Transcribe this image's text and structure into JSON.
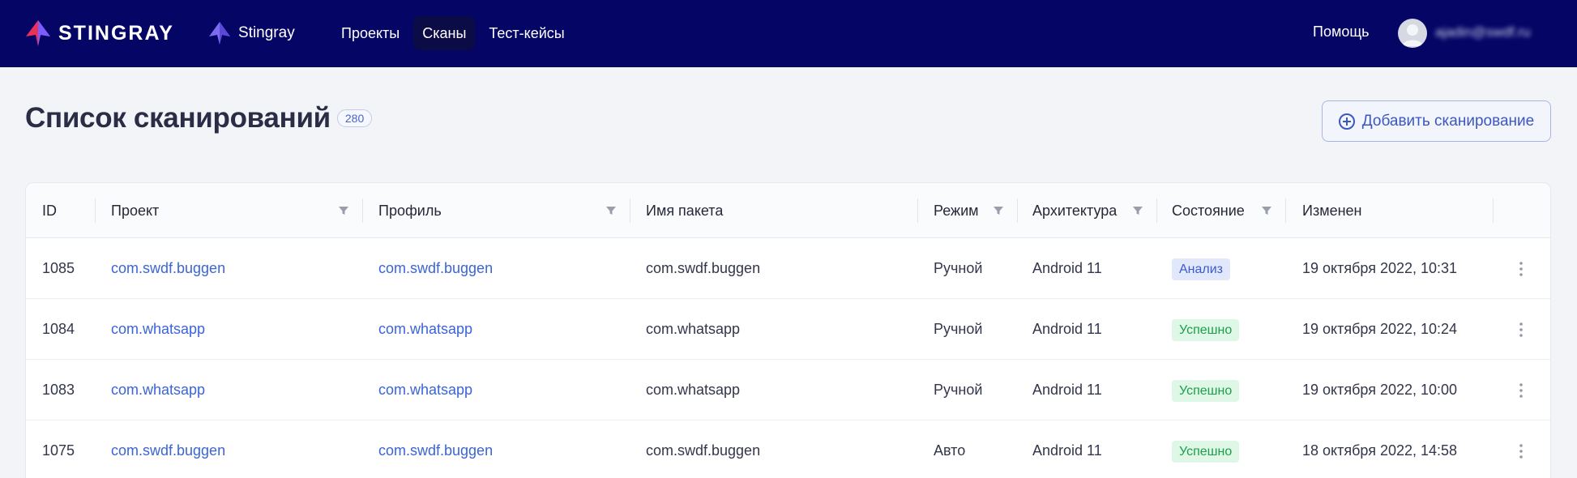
{
  "brand": {
    "name": "STINGRAY"
  },
  "app": {
    "name": "Stingray"
  },
  "nav": [
    "Проекты",
    "Сканы",
    "Тест-кейсы"
  ],
  "nav_active": 1,
  "header": {
    "help": "Помощь",
    "user": "ajadin@swdf.ru"
  },
  "page": {
    "title": "Список сканирований",
    "count": "280",
    "add_button": "Добавить сканирование"
  },
  "table": {
    "headers": [
      "ID",
      "Проект",
      "Профиль",
      "Имя пакета",
      "Режим",
      "Архитектура",
      "Состояние",
      "Изменен"
    ],
    "rows": [
      {
        "id": "1085",
        "project": "com.swdf.buggen",
        "profile": "com.swdf.buggen",
        "package": "com.swdf.buggen",
        "mode": "Ручной",
        "arch": "Android 11",
        "status": "Анализ",
        "status_kind": "analysis",
        "modified": "19 октября 2022, 10:31"
      },
      {
        "id": "1084",
        "project": "com.whatsapp",
        "profile": "com.whatsapp",
        "package": "com.whatsapp",
        "mode": "Ручной",
        "arch": "Android 11",
        "status": "Успешно",
        "status_kind": "success",
        "modified": "19 октября 2022, 10:24"
      },
      {
        "id": "1083",
        "project": "com.whatsapp",
        "profile": "com.whatsapp",
        "package": "com.whatsapp",
        "mode": "Ручной",
        "arch": "Android 11",
        "status": "Успешно",
        "status_kind": "success",
        "modified": "19 октября 2022, 10:00"
      },
      {
        "id": "1075",
        "project": "com.swdf.buggen",
        "profile": "com.swdf.buggen",
        "package": "com.swdf.buggen",
        "mode": "Авто",
        "arch": "Android 11",
        "status": "Успешно",
        "status_kind": "success",
        "modified": "18 октября 2022, 14:58"
      }
    ]
  },
  "icons": {
    "logo": "stingray-logo-icon",
    "app": "stingray-app-icon",
    "filter": "filter-icon",
    "more": "kebab-menu-icon",
    "add": "plus-circle-icon",
    "avatar": "user-avatar-icon"
  }
}
